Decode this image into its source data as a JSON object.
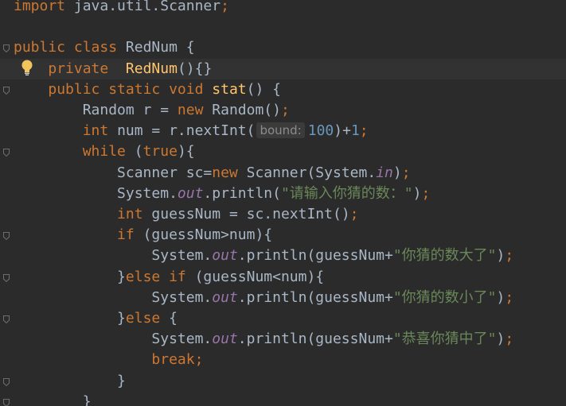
{
  "lines": [
    {
      "segs": [
        [
          "kw",
          "import"
        ],
        [
          "pl",
          " java.util.Scanner"
        ],
        [
          "semi",
          ";"
        ]
      ]
    },
    {
      "segs": []
    },
    {
      "segs": [
        [
          "kw",
          "public class "
        ],
        [
          "pl",
          "RedNum {"
        ]
      ]
    },
    {
      "segs": [
        [
          "pl",
          "    "
        ],
        [
          "kw",
          "private  "
        ],
        [
          "fn",
          "RedNum"
        ],
        [
          "pl",
          "(){}"
        ]
      ],
      "current": true
    },
    {
      "segs": [
        [
          "pl",
          "    "
        ],
        [
          "kw",
          "public static void "
        ],
        [
          "fn",
          "stat"
        ],
        [
          "pl",
          "() {"
        ]
      ]
    },
    {
      "segs": [
        [
          "pl",
          "        Random r = "
        ],
        [
          "kw",
          "new "
        ],
        [
          "pl",
          "Random()"
        ],
        [
          "semi",
          ";"
        ]
      ]
    },
    {
      "segs": [
        [
          "pl",
          "        "
        ],
        [
          "kw",
          "int "
        ],
        [
          "pl",
          "num = r.nextInt("
        ],
        [
          "hint",
          "bound:"
        ],
        [
          "num",
          "100"
        ],
        [
          "pl",
          ")+"
        ],
        [
          "num",
          "1"
        ],
        [
          "semi",
          ";"
        ]
      ]
    },
    {
      "segs": [
        [
          "pl",
          "        "
        ],
        [
          "kw",
          "while "
        ],
        [
          "pl",
          "("
        ],
        [
          "kw",
          "true"
        ],
        [
          "pl",
          "){"
        ]
      ]
    },
    {
      "segs": [
        [
          "pl",
          "            Scanner sc="
        ],
        [
          "kw",
          "new "
        ],
        [
          "pl",
          "Scanner(System."
        ],
        [
          "fld",
          "in"
        ],
        [
          "pl",
          ")"
        ],
        [
          "semi",
          ";"
        ]
      ]
    },
    {
      "segs": [
        [
          "pl",
          "            System."
        ],
        [
          "fld",
          "out"
        ],
        [
          "pl",
          ".println("
        ],
        [
          "str",
          "\"请输入你猜的数：\""
        ],
        [
          "pl",
          ")"
        ],
        [
          "semi",
          ";"
        ]
      ]
    },
    {
      "segs": [
        [
          "pl",
          "            "
        ],
        [
          "kw",
          "int "
        ],
        [
          "pl",
          "guessNum = sc.nextInt()"
        ],
        [
          "semi",
          ";"
        ]
      ]
    },
    {
      "segs": [
        [
          "pl",
          "            "
        ],
        [
          "kw",
          "if "
        ],
        [
          "pl",
          "(guessNum>num){"
        ]
      ]
    },
    {
      "segs": [
        [
          "pl",
          "                System."
        ],
        [
          "fld",
          "out"
        ],
        [
          "pl",
          ".println(guessNum+"
        ],
        [
          "str",
          "\"你猜的数大了\""
        ],
        [
          "pl",
          ")"
        ],
        [
          "semi",
          ";"
        ]
      ]
    },
    {
      "segs": [
        [
          "pl",
          "            }"
        ],
        [
          "kw",
          "else if "
        ],
        [
          "pl",
          "(guessNum<num){"
        ]
      ]
    },
    {
      "segs": [
        [
          "pl",
          "                System."
        ],
        [
          "fld",
          "out"
        ],
        [
          "pl",
          ".println(guessNum+"
        ],
        [
          "str",
          "\"你猜的数小了\""
        ],
        [
          "pl",
          ")"
        ],
        [
          "semi",
          ";"
        ]
      ]
    },
    {
      "segs": [
        [
          "pl",
          "            }"
        ],
        [
          "kw",
          "else "
        ],
        [
          "pl",
          "{"
        ]
      ]
    },
    {
      "segs": [
        [
          "pl",
          "                System."
        ],
        [
          "fld",
          "out"
        ],
        [
          "pl",
          ".println(guessNum+"
        ],
        [
          "str",
          "\"恭喜你猜中了\""
        ],
        [
          "pl",
          ")"
        ],
        [
          "semi",
          ";"
        ]
      ]
    },
    {
      "segs": [
        [
          "pl",
          "                "
        ],
        [
          "kw",
          "break"
        ],
        [
          "semi",
          ";"
        ]
      ]
    },
    {
      "segs": [
        [
          "pl",
          "            }"
        ]
      ]
    },
    {
      "segs": [
        [
          "pl",
          "        }"
        ]
      ]
    }
  ],
  "folds": [
    2,
    4,
    7,
    11,
    13,
    15,
    18,
    19
  ],
  "icons": {
    "intention": "lightbulb-icon",
    "fold": "fold-marker-icon"
  },
  "colors": {
    "background": "#2b2b2b",
    "keyword": "#cc7832",
    "plain": "#a9b7c6",
    "method": "#ffc66d",
    "number": "#6897bb",
    "string": "#6a8759",
    "field": "#9876aa"
  }
}
